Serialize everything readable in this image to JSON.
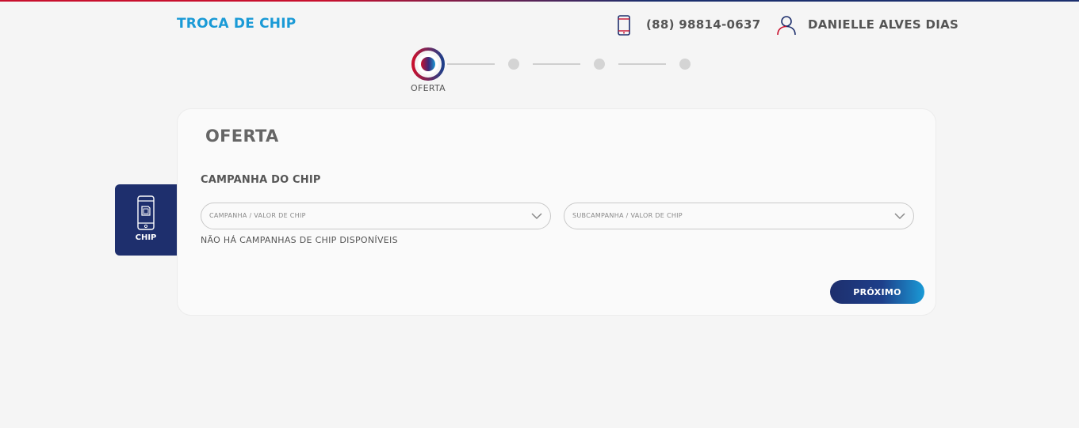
{
  "header": {
    "title": "TROCA DE CHIP",
    "phone_icon": "mobile-phone-icon",
    "phone_number": "(88) 98814-0637",
    "user_icon": "user-icon",
    "user_name": "DANIELLE ALVES DIAS"
  },
  "stepper": {
    "current_label": "OFERTA",
    "total_steps": 4,
    "current_step": 1
  },
  "side_tab": {
    "icon": "sim-card-phone-icon",
    "label": "CHIP"
  },
  "card": {
    "title": "OFERTA",
    "section_label": "CAMPANHA DO CHIP",
    "campaign_select": {
      "placeholder": "CAMPANHA / VALOR DE CHIP",
      "value": ""
    },
    "subcampaign_select": {
      "placeholder": "SUBCAMPANHA / VALOR DE CHIP",
      "value": ""
    },
    "info_text": "NÃO HÁ CAMPANHAS DE CHIP DISPONÍVEIS",
    "next_button": "PRÓXIMO"
  },
  "colors": {
    "brand_blue": "#1a9ad6",
    "brand_navy": "#1e2f6d",
    "brand_red": "#c8102e",
    "background": "#f5f5f5"
  }
}
